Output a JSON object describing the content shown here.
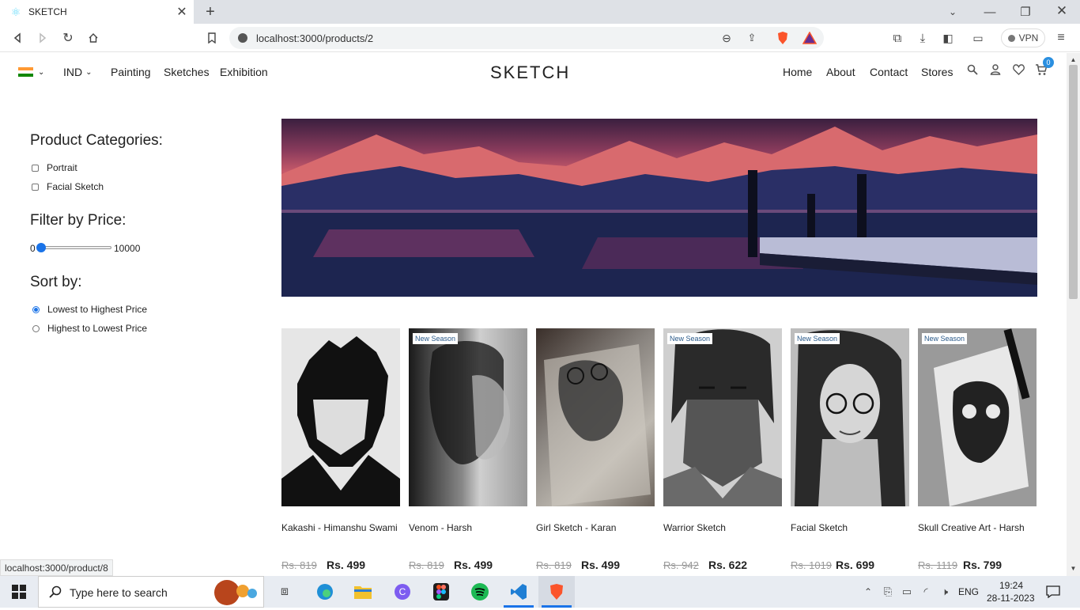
{
  "browser": {
    "tab_title": "SKETCH",
    "url": "localhost:3000/products/2",
    "vpn_label": "VPN",
    "status_url": "localhost:3000/product/8"
  },
  "header": {
    "currency": "IND",
    "nav_left": [
      "Painting",
      "Sketches",
      "Exhibition"
    ],
    "brand": "SKETCH",
    "nav_right": [
      "Home",
      "About",
      "Contact",
      "Stores"
    ],
    "cart_count": "0"
  },
  "sidebar": {
    "categories_title": "Product Categories:",
    "categories": [
      "Portrait",
      "Facial Sketch"
    ],
    "price_title": "Filter by Price:",
    "price_min": "0",
    "price_max": "10000",
    "price_value": 0,
    "sort_title": "Sort by:",
    "sort_options": [
      "Lowest to Highest Price",
      "Highest to Lowest Price"
    ],
    "sort_selected": "Lowest to Highest Price"
  },
  "products": [
    {
      "title": "Kakashi - Himanshu Swami",
      "old_price": "Rs. 819",
      "price": "Rs. 499",
      "badge": ""
    },
    {
      "title": "Venom - Harsh",
      "old_price": "Rs. 819",
      "price": "Rs. 499",
      "badge": "New Season"
    },
    {
      "title": "Girl Sketch - Karan",
      "old_price": "Rs. 819",
      "price": "Rs. 499",
      "badge": ""
    },
    {
      "title": "Warrior Sketch",
      "old_price": "Rs. 942",
      "price": "Rs. 622",
      "badge": "New Season"
    },
    {
      "title": "Facial Sketch",
      "old_price": "Rs. 1019",
      "price": "Rs. 699",
      "badge": "New Season"
    },
    {
      "title": "Skull Creative Art - Harsh",
      "old_price": "Rs. 1119",
      "price": "Rs. 799",
      "badge": "New Season"
    }
  ],
  "taskbar": {
    "search_placeholder": "Type here to search",
    "language": "ENG",
    "time": "19:24",
    "date": "28-11-2023"
  }
}
